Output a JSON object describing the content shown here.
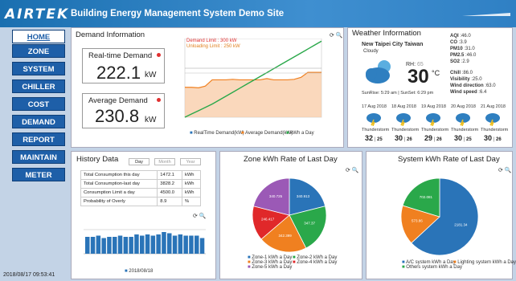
{
  "header": {
    "logo": "AIRTEK",
    "site_title": "Building Energy Management System Demo Site"
  },
  "sidebar": {
    "items": [
      {
        "label": "HOME",
        "active": true
      },
      {
        "label": "ZONE"
      },
      {
        "label": "SYSTEM"
      },
      {
        "label": "CHILLER"
      },
      {
        "label": "COST"
      },
      {
        "label": "DEMAND"
      },
      {
        "label": "REPORT"
      },
      {
        "label": "MAINTAIN"
      },
      {
        "label": "METER"
      }
    ],
    "timestamp": "2018/08/17 09:53:41"
  },
  "demand": {
    "title": "Demand Information",
    "realtime_label": "Real-time Demand",
    "realtime_value": "222.1",
    "realtime_unit": "kW",
    "average_label": "Average Demand",
    "average_value": "230.8",
    "average_unit": "kW",
    "limit_text": "Demand Limit : 300 kW",
    "unloading_text": "Unloading Limit : 250 kW",
    "legend": [
      "RealTime Demand(kW)",
      "Average Demand(kW)",
      "kWh a Day"
    ]
  },
  "weather": {
    "title": "Weather Information",
    "city": "New Taipei City  Taiwan",
    "condition": "Cloudy",
    "rh_label": "RH:",
    "rh_value": "65",
    "temp": "30",
    "temp_unit": "°C",
    "sunrise": "SunRise: 5:29 am  |  SunSet: 6:29 pm",
    "stats": [
      {
        "k": "AQI",
        "v": ":46.0"
      },
      {
        "k": "CO",
        "v": ":3.9"
      },
      {
        "k": "PM10",
        "v": ":31.0"
      },
      {
        "k": "PM2.5",
        "v": ":46.0"
      },
      {
        "k": "SO2",
        "v": ":2.9"
      }
    ],
    "stats2": [
      {
        "k": "Chill",
        "v": ":86.0"
      },
      {
        "k": "Visibility",
        "v": ":25.0"
      },
      {
        "k": "Wind direction",
        "v": ":63.0"
      },
      {
        "k": "Wind speed",
        "v": ":6.4"
      }
    ],
    "forecast": [
      {
        "date": "17 Aug 2018",
        "label": "Thunderstorm",
        "hi": "32",
        "lo": "25"
      },
      {
        "date": "18 Aug 2018",
        "label": "Thunderstorm",
        "hi": "30",
        "lo": "26"
      },
      {
        "date": "19 Aug 2018",
        "label": "Thunderstorm",
        "hi": "29",
        "lo": "26"
      },
      {
        "date": "20 Aug 2018",
        "label": "Thunderstorm",
        "hi": "30",
        "lo": "25"
      },
      {
        "date": "21 Aug 2018",
        "label": "Thunderstorm",
        "hi": "30",
        "lo": "26"
      }
    ]
  },
  "history": {
    "title": "History Data",
    "tabs": [
      "Day",
      "Month",
      "Year"
    ],
    "rows": [
      {
        "label": "Total Consumption this day",
        "value": "1472.1",
        "unit": "kWh"
      },
      {
        "label": "Total Consumption-last day",
        "value": "3828.2",
        "unit": "kWh"
      },
      {
        "label": "Consumption Limit a day",
        "value": "4500.0",
        "unit": "kWh"
      },
      {
        "label": "Probability of Overly",
        "value": "8.9",
        "unit": "%"
      }
    ],
    "legend": "2018/08/18"
  },
  "zone": {
    "title": "Zone kWh Rate of Last Day",
    "legend": [
      "Zone-1 kWh a Day",
      "Zone-2 kWh a Day",
      "Zone-3 kWh a Day",
      "Zone-4 kWh a Day",
      "Zone-5 kWh a Day"
    ]
  },
  "system": {
    "title": "System kWh Rate of Last Day",
    "legend": [
      "A/C system kWh a Day",
      "Lighting system kWh a Day",
      "Others system kWh a Day"
    ]
  },
  "chart_data": [
    {
      "type": "line",
      "title": "",
      "series": [
        {
          "name": "RealTime Demand(kW)",
          "values": [
            120,
            120,
            118,
            125,
            150,
            150,
            150,
            152,
            150,
            150,
            150,
            150,
            155,
            150,
            150,
            150,
            152,
            160,
            180,
            180,
            180
          ]
        },
        {
          "name": "kWh a Day",
          "values": [
            0,
            50,
            100,
            150,
            200,
            260,
            320,
            380,
            440,
            500,
            560,
            620,
            680,
            740,
            800,
            860,
            920,
            980,
            1040,
            1100,
            1160
          ]
        }
      ]
    },
    {
      "type": "bar",
      "title": "",
      "series": [
        {
          "name": "2018/08/18",
          "values": [
            140,
            140,
            150,
            130,
            140,
            140,
            150,
            140,
            140,
            160,
            150,
            160,
            150,
            160,
            180,
            170,
            150,
            160,
            150,
            150,
            150,
            130
          ]
        }
      ]
    },
    {
      "type": "pie",
      "title": "Zone kWh Rate of Last Day",
      "categories": [
        "Zone-1 kWh a Day",
        "Zone-2 kWh a Day",
        "Zone-3 kWh a Day",
        "Zone-4 kWh a Day",
        "Zone-5 kWh a Day"
      ],
      "values": [
        340.913,
        347.37,
        342.399,
        246.417,
        340.725
      ]
    },
    {
      "type": "pie",
      "title": "System kWh Rate of Last Day",
      "categories": [
        "A/C system kWh a Day",
        "Lighting system kWh a Day",
        "Others system kWh a Day"
      ],
      "values": [
        2181.34,
        573.86,
        702.081
      ]
    }
  ],
  "colors": {
    "nav": "#1e5fa8",
    "header": "#2f80c4",
    "orange": "#f08020",
    "green": "#2aa84a",
    "blue": "#2a74b8",
    "red": "#e0282a",
    "purple": "#9b59b6"
  }
}
